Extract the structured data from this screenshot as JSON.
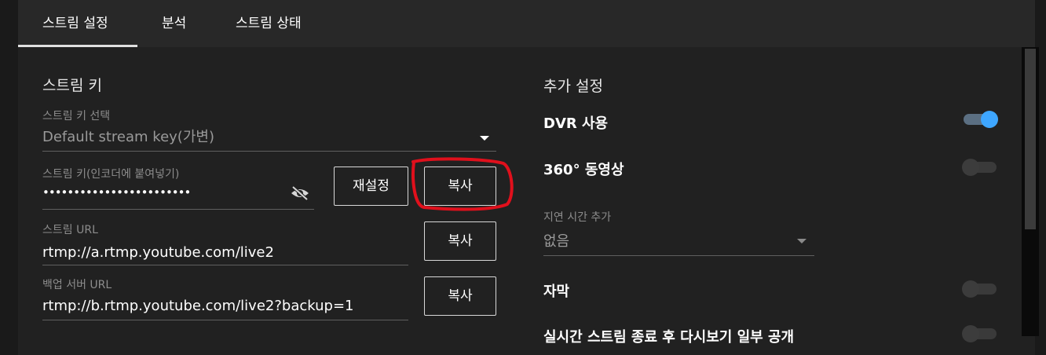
{
  "tabs": [
    {
      "label": "스트림 설정",
      "active": true
    },
    {
      "label": "분석",
      "active": false
    },
    {
      "label": "스트림 상태",
      "active": false
    }
  ],
  "stream_key": {
    "section_title": "스트림 키",
    "select_label": "스트림 키 선택",
    "select_value": "Default stream key(가변)",
    "key_label": "스트림 키(인코더에 붙여넣기)",
    "key_value": "••••••••••••••••••••••••",
    "reset_button": "재설정",
    "copy_button": "복사"
  },
  "stream_url": {
    "label": "스트림 URL",
    "value": "rtmp://a.rtmp.youtube.com/live2",
    "copy_button": "복사"
  },
  "backup_url": {
    "label": "백업 서버 URL",
    "value": "rtmp://b.rtmp.youtube.com/live2?backup=1",
    "copy_button": "복사"
  },
  "additional": {
    "section_title": "추가 설정",
    "dvr": {
      "label": "DVR 사용",
      "enabled": true
    },
    "v360": {
      "label": "360° 동영상",
      "enabled": false
    },
    "latency": {
      "label": "지연 시간 추가",
      "value": "없음"
    },
    "captions": {
      "label": "자막",
      "enabled": false
    },
    "unlist_after": {
      "label": "실시간 스트림 종료 후 다시보기 일부 공개",
      "enabled": false
    }
  },
  "colors": {
    "accent": "#3ea6ff",
    "annotation": "#e0101c",
    "panel_bg": "#212121",
    "tab_bg": "#282828"
  }
}
